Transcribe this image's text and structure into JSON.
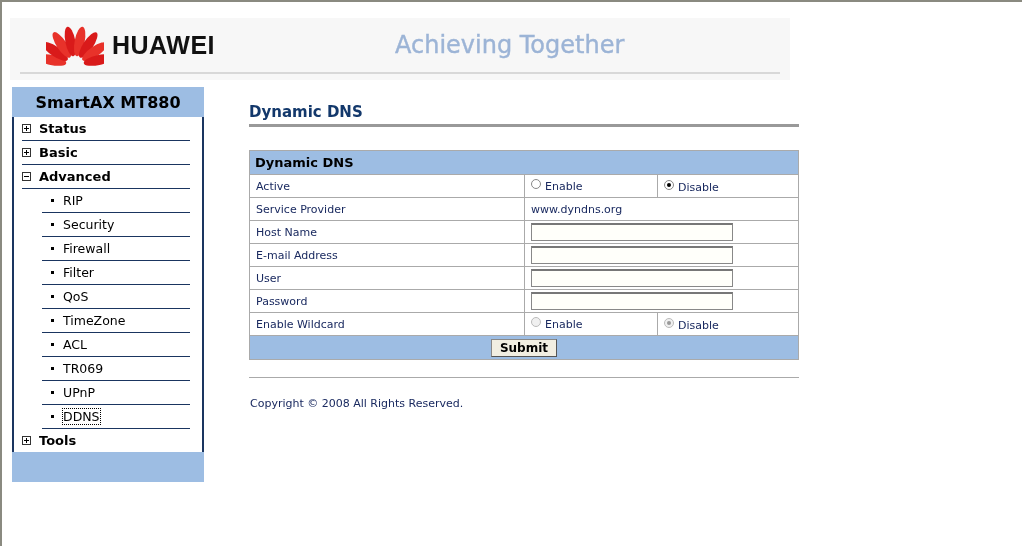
{
  "header": {
    "brand": "HUAWEI",
    "tagline": "Achieving Together"
  },
  "sidebar": {
    "title": "SmartAX MT880",
    "items": [
      {
        "label": "Status",
        "expanded": false
      },
      {
        "label": "Basic",
        "expanded": false
      },
      {
        "label": "Advanced",
        "expanded": true,
        "children": [
          {
            "label": "RIP",
            "selected": false
          },
          {
            "label": "Security",
            "selected": false
          },
          {
            "label": "Firewall",
            "selected": false
          },
          {
            "label": "Filter",
            "selected": false
          },
          {
            "label": "QoS",
            "selected": false
          },
          {
            "label": "TimeZone",
            "selected": false
          },
          {
            "label": "ACL",
            "selected": false
          },
          {
            "label": "TR069",
            "selected": false
          },
          {
            "label": "UPnP",
            "selected": false
          },
          {
            "label": "DDNS",
            "selected": true
          }
        ]
      },
      {
        "label": "Tools",
        "expanded": false
      }
    ]
  },
  "page_title": "Dynamic DNS",
  "form": {
    "title": "Dynamic DNS",
    "rows": [
      {
        "kind": "radio",
        "label": "Active",
        "disabled": false,
        "options": [
          {
            "label": "Enable",
            "selected": false
          },
          {
            "label": "Disable",
            "selected": true
          }
        ]
      },
      {
        "kind": "text",
        "label": "Service Provider",
        "value": "www.dyndns.org"
      },
      {
        "kind": "input",
        "label": "Host Name"
      },
      {
        "kind": "input",
        "label": "E-mail Address"
      },
      {
        "kind": "input",
        "label": "User"
      },
      {
        "kind": "input",
        "label": "Password"
      },
      {
        "kind": "radio",
        "label": "Enable Wildcard",
        "disabled": true,
        "options": [
          {
            "label": "Enable",
            "selected": false
          },
          {
            "label": "Disable",
            "selected": true
          }
        ]
      }
    ],
    "submit": "Submit"
  },
  "footer": "Copyright © 2008 All Rights Reserved."
}
